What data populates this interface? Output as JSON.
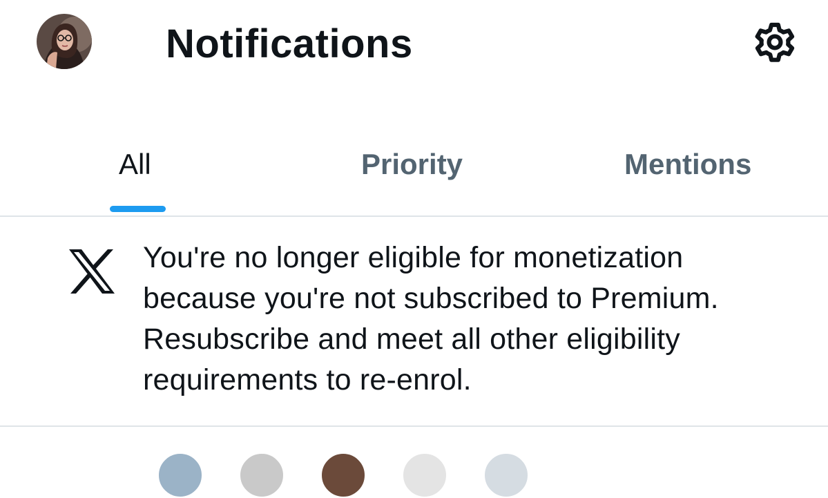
{
  "header": {
    "title": "Notifications",
    "avatar_icon": "user-avatar",
    "settings_icon": "gear-icon"
  },
  "tabs": [
    {
      "label": "All",
      "selected": true
    },
    {
      "label": "Priority",
      "selected": false
    },
    {
      "label": "Mentions",
      "selected": false
    }
  ],
  "notification": {
    "icon": "x-logo-icon",
    "lines": [
      "You're no longer eligible for monetization",
      "because you're not subscribed to Premium.",
      "Resubscribe and meet all other eligibility",
      "requirements to re-enrol."
    ]
  },
  "colors": {
    "accent": "#1d9bf0",
    "text_primary": "#0f1419",
    "text_secondary": "#536471",
    "divider": "#dfe4e8"
  }
}
